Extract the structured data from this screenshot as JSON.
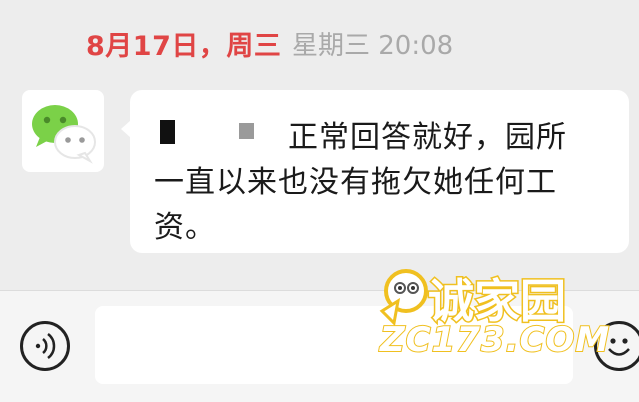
{
  "timestamp": {
    "overlay_label": "8月17日，周三",
    "system_label": "星期三 20:08"
  },
  "message": {
    "line1": "正常回答就好，园所",
    "line2": "一直以来也没有拖欠她任何工",
    "line3": "资。"
  },
  "input_bar": {
    "voice_icon": "voice-icon",
    "emoji_icon": "emoji-icon"
  },
  "watermark": {
    "cn": "诚家园",
    "en": "ZC173.COM"
  },
  "colors": {
    "overlay_red": "#e04545",
    "background": "#ededed",
    "wechat_green": "#7bd148",
    "watermark_yellow": "#f0c020"
  }
}
